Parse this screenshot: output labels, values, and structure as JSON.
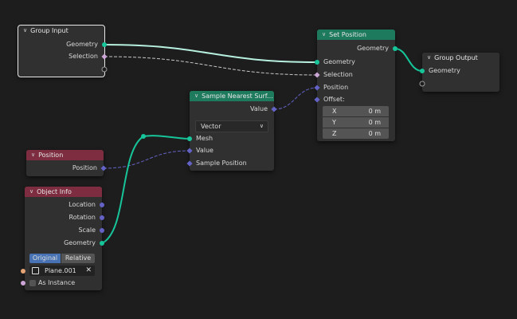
{
  "colors": {
    "background": "#1d1d1d",
    "node_body": "#303030",
    "input_header": "#303030",
    "geometry_header": "#1e7a5d",
    "input_field_header": "#7e2d40",
    "geometry_socket": "#17c59a",
    "vector_socket": "#6363c7",
    "object_socket": "#e6a375",
    "bool_socket": "#cca6d6",
    "toggle_active": "#4772b3"
  },
  "icons": {
    "collapse": "chevron-down-icon",
    "clear": "x-icon",
    "object": "object-icon"
  },
  "nodes": {
    "group_input": {
      "title": "Group Input",
      "outputs": [
        "Geometry",
        "Selection"
      ]
    },
    "set_position": {
      "title": "Set Position",
      "output": "Geometry",
      "inputs": [
        "Geometry",
        "Selection",
        "Position",
        "Offset:"
      ],
      "offset": [
        {
          "axis": "X",
          "value": "0 m"
        },
        {
          "axis": "Y",
          "value": "0 m"
        },
        {
          "axis": "Z",
          "value": "0 m"
        }
      ]
    },
    "group_output": {
      "title": "Group Output",
      "input": "Geometry"
    },
    "sample_nearest": {
      "title": "Sample Nearest Surf...",
      "output": "Value",
      "data_type": "Vector",
      "inputs": [
        "Mesh",
        "Value",
        "Sample Position"
      ]
    },
    "position": {
      "title": "Position",
      "output": "Position"
    },
    "object_info": {
      "title": "Object Info",
      "outputs": [
        "Location",
        "Rotation",
        "Scale",
        "Geometry"
      ],
      "transform_space": [
        "Original",
        "Relative"
      ],
      "active_space": "Original",
      "object": "Plane.001",
      "as_instance_label": "As Instance",
      "as_instance": false
    }
  }
}
